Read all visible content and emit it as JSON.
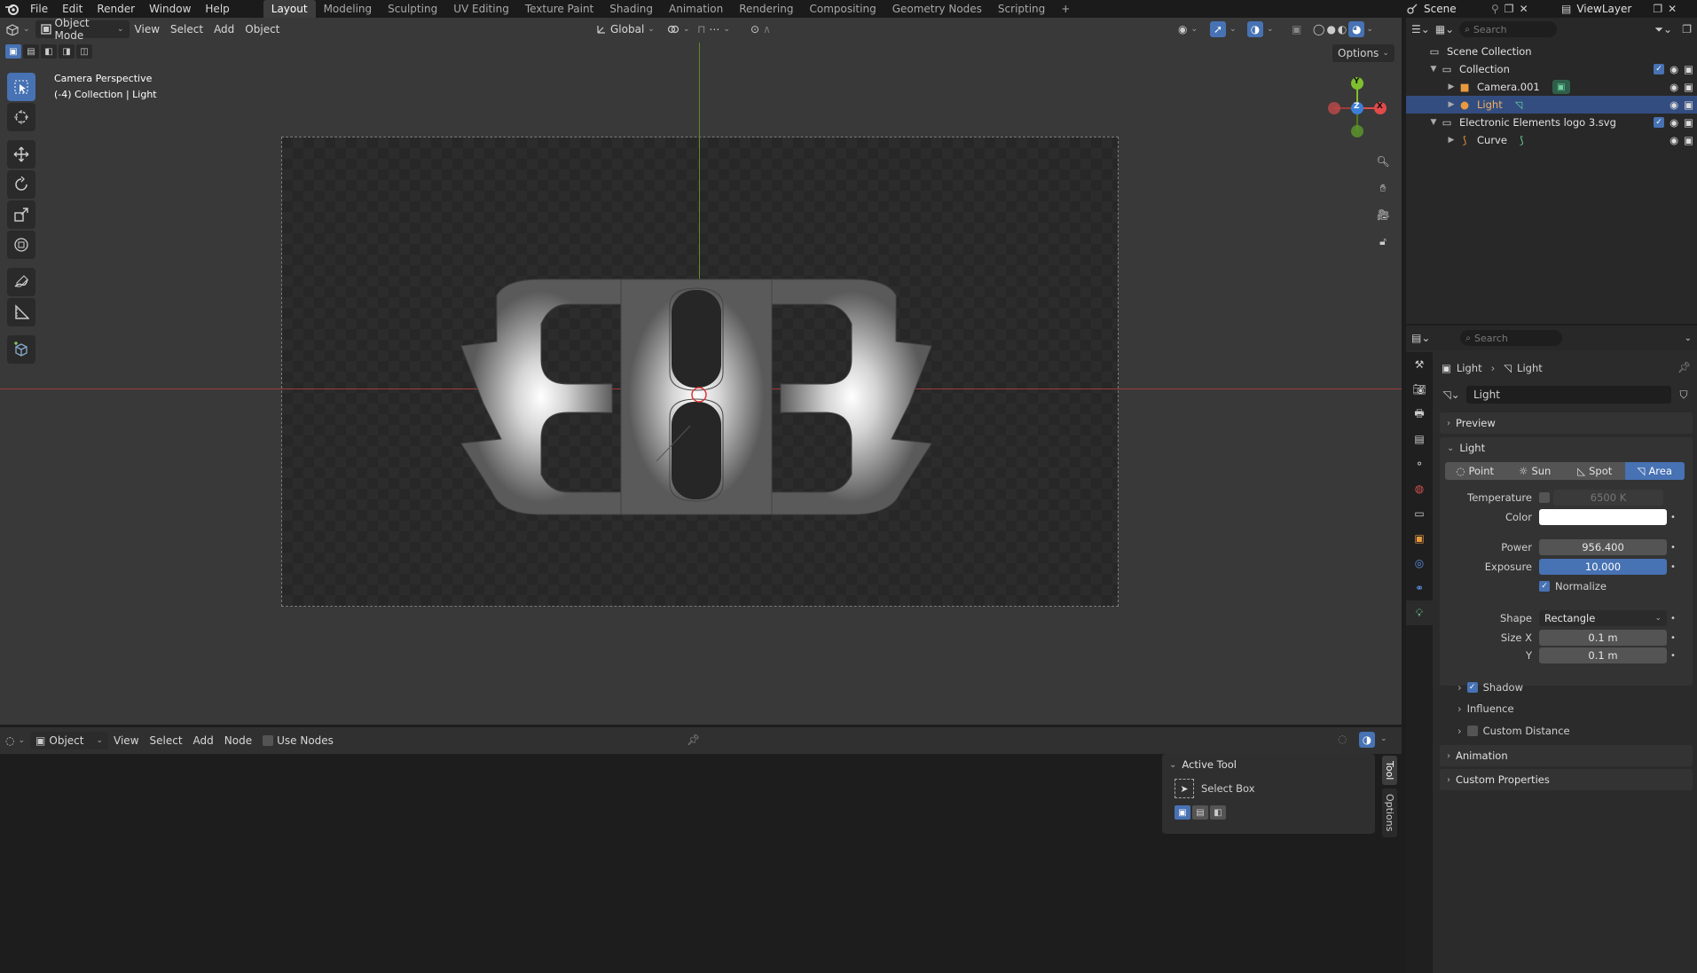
{
  "menus": [
    "File",
    "Edit",
    "Render",
    "Window",
    "Help"
  ],
  "workspaces": [
    "Layout",
    "Modeling",
    "Sculpting",
    "UV Editing",
    "Texture Paint",
    "Shading",
    "Animation",
    "Rendering",
    "Compositing",
    "Geometry Nodes",
    "Scripting"
  ],
  "active_workspace": "Layout",
  "scene_name": "Scene",
  "view_layer": "ViewLayer",
  "viewport": {
    "mode": "Object Mode",
    "menus": [
      "View",
      "Select",
      "Add",
      "Object"
    ],
    "transform_orientation": "Global",
    "options_label": "Options",
    "info_line1": "Camera Perspective",
    "info_line2": "(-4) Collection | Light",
    "gizmo": {
      "y": "Y",
      "z": "Z",
      "x": "X"
    }
  },
  "outliner": {
    "search_placeholder": "Search",
    "rows": [
      {
        "label": "Scene Collection"
      },
      {
        "label": "Collection"
      },
      {
        "label": "Camera.001"
      },
      {
        "label": "Light"
      },
      {
        "label": "Electronic Elements logo 3.svg"
      },
      {
        "label": "Curve"
      }
    ]
  },
  "properties": {
    "search_placeholder": "Search",
    "breadcrumb_object": "Light",
    "breadcrumb_data": "Light",
    "datablock_name": "Light",
    "panels": {
      "preview": "Preview",
      "light": "Light",
      "animation": "Animation",
      "custom_properties": "Custom Properties"
    },
    "light_types": [
      "Point",
      "Sun",
      "Spot",
      "Area"
    ],
    "active_light_type": "Area",
    "temperature_label": "Temperature",
    "temperature_value": "6500 K",
    "color_label": "Color",
    "power_label": "Power",
    "power_value": "956.400",
    "exposure_label": "Exposure",
    "exposure_value": "10.000",
    "normalize_label": "Normalize",
    "shape_label": "Shape",
    "shape_value": "Rectangle",
    "size_x_label": "Size X",
    "size_x_value": "0.1 m",
    "size_y_label": "Y",
    "size_y_value": "0.1 m",
    "shadow_label": "Shadow",
    "influence_label": "Influence",
    "custom_distance_label": "Custom Distance"
  },
  "node_editor": {
    "type": "Object",
    "menus": [
      "View",
      "Select",
      "Add",
      "Node"
    ],
    "use_nodes_label": "Use Nodes",
    "active_tool_title": "Active Tool",
    "active_tool_name": "Select Box",
    "side_tabs": [
      "Tool",
      "Options"
    ]
  },
  "colors": {
    "accent": "#4772b3",
    "selection": "#334d80",
    "x_axis": "#e04a4a",
    "y_axis": "#7fbf2f",
    "z_axis": "#3c7fd8"
  }
}
